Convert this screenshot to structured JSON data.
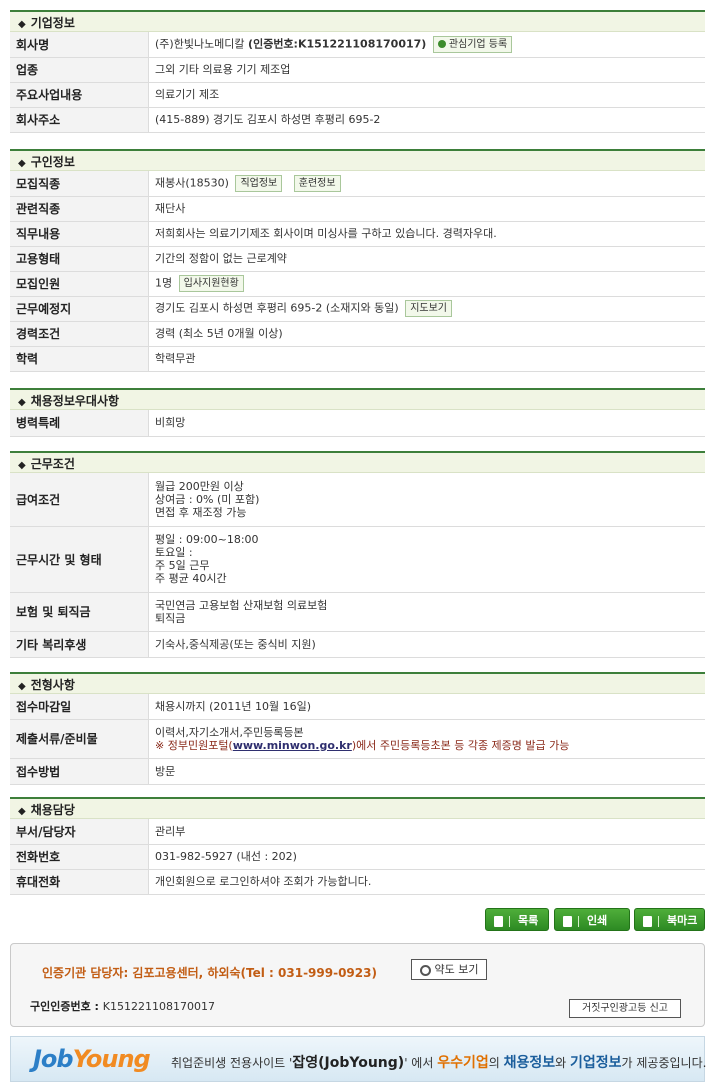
{
  "company": {
    "title": "기업정보",
    "rows": [
      {
        "k": "회사명",
        "v": "(주)한빛나노메디칼",
        "cert_prefix": "(인증번호:K151221108170017)",
        "btn": "관심기업 등록"
      },
      {
        "k": "업종",
        "v": "그외 기타 의료용 기기 제조업"
      },
      {
        "k": "주요사업내용",
        "v": "의료기기 제조"
      },
      {
        "k": "회사주소",
        "v": "(415-889) 경기도 김포시 하성면 후평리 695-2"
      }
    ]
  },
  "recruit": {
    "title": "구인정보",
    "job": {
      "k": "모집직종",
      "v": "재봉사(18530)",
      "btn1": "직업정보",
      "btn2": "훈련정보"
    },
    "related": {
      "k": "관련직종",
      "v": "재단사"
    },
    "duty": {
      "k": "직무내용",
      "v": "저희회사는 의료기기제조 회사이며 미싱사를 구하고 있습니다. 경력자우대."
    },
    "employ": {
      "k": "고용형태",
      "v": "기간의 정함이 없는 근로계약"
    },
    "count": {
      "k": "모집인원",
      "v": "1명",
      "btn": "입사지원현황"
    },
    "place": {
      "k": "근무예정지",
      "v": "경기도 김포시 하성면 후평리 695-2 (소재지와 동일)",
      "btn": "지도보기"
    },
    "career": {
      "k": "경력조건",
      "v": "경력 (최소 5년 0개월 이상)"
    },
    "edu": {
      "k": "학력",
      "v": "학력무관"
    }
  },
  "pref": {
    "title": "채용정보우대사항",
    "military": {
      "k": "병력특례",
      "v": "비희망"
    }
  },
  "work": {
    "title": "근무조건",
    "pay": {
      "k": "급여조건",
      "l1": "월급 200만원 이상",
      "l2": "상여금 : 0% (미 포함)",
      "l3": "면접 후 재조정 가능"
    },
    "hours": {
      "k": "근무시간 및 형태",
      "l1": "평일 : 09:00~18:00",
      "l2": "토요일 :",
      "l3": "주 5일 근무",
      "l4": "주 평균 40시간"
    },
    "insurance": {
      "k": "보험 및 퇴직금",
      "l1": "국민연금 고용보험 산재보험 의료보험",
      "l2": "퇴직금"
    },
    "welfare": {
      "k": "기타 복리후생",
      "v": "기숙사,중식제공(또는 중식비 지원)"
    }
  },
  "process": {
    "title": "전형사항",
    "deadline": {
      "k": "접수마감일",
      "v": "채용시까지 (2011년 10월 16일)"
    },
    "docs": {
      "k": "제출서류/준비물",
      "l1": "이력서,자기소개서,주민등록등본",
      "l2a": "※ 정부민원포털(",
      "l2link": "www.minwon.go.kr",
      "l2b": ")에서 주민등록등초본 등 각종 제증명 발급 가능"
    },
    "method": {
      "k": "접수방법",
      "v": "방문"
    }
  },
  "manager": {
    "title": "채용담당",
    "dept": {
      "k": "부서/담당자",
      "v": "관리부"
    },
    "phone": {
      "k": "전화번호",
      "v": "031-982-5927 (내선 : 202)"
    },
    "mobile": {
      "k": "휴대전화",
      "v": "개인회원으로 로그인하셔야 조회가 가능합니다."
    }
  },
  "buttons": {
    "list": "목록",
    "print": "인쇄",
    "bookmark": "북마크"
  },
  "info": {
    "contact": "인증기관 담당자: 김포고용센터, 하외숙(Tel : 031-999-0923)",
    "guide": "약도 보기",
    "cert_label": "구인인증번호 :",
    "cert_value": "K151221108170017",
    "report": "거짓구인광고등 신고"
  },
  "banner": {
    "logo_a": "Job",
    "logo_b": "Young",
    "t1": "취업준비생 전용사이트 '",
    "t2": "잡영(JobYoung)",
    "t3": "' 에서 ",
    "t4": "우수기업",
    "t5": "의 ",
    "t6": "채용정보",
    "t7": "와 ",
    "t8": "기업정보",
    "t9": "가 제공중입니다."
  }
}
